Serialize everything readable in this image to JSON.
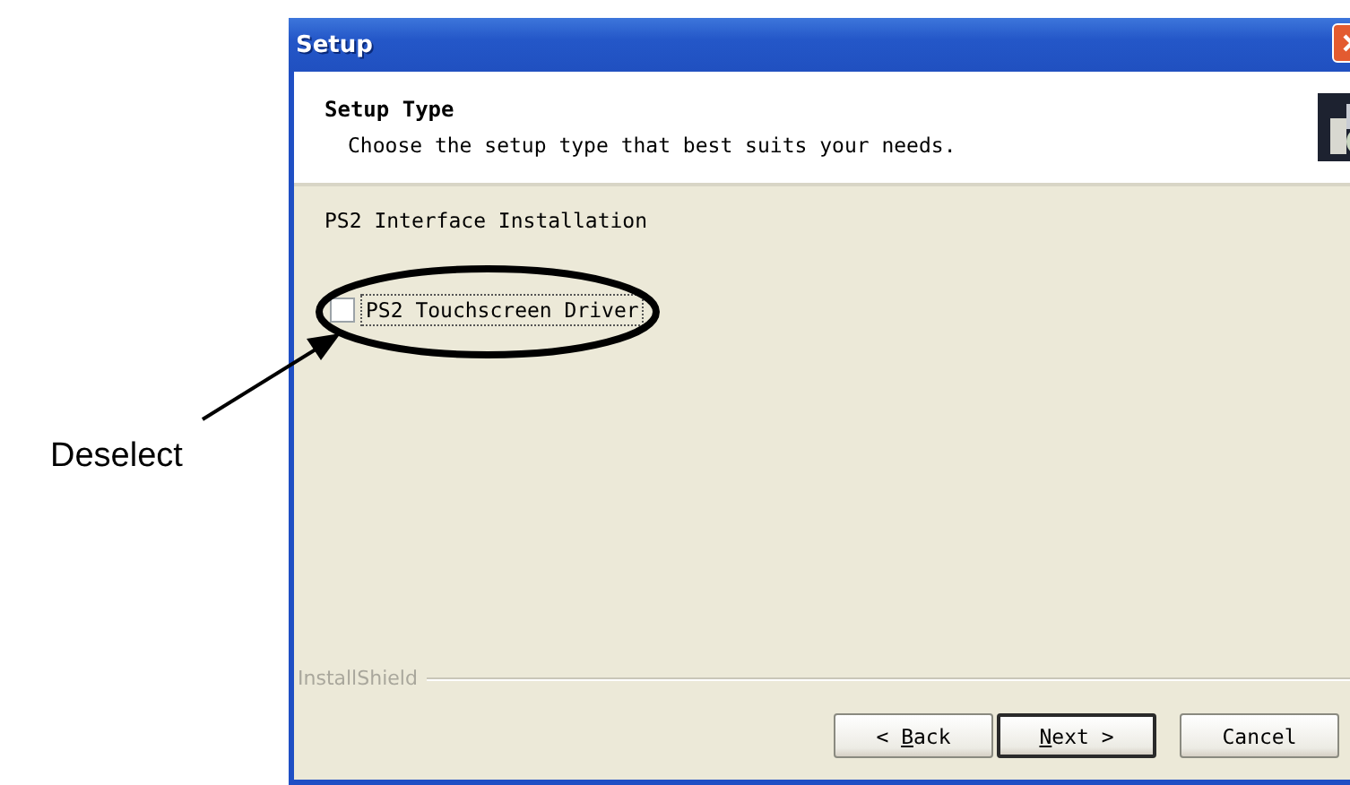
{
  "window": {
    "title": "Setup"
  },
  "header": {
    "title": "Setup Type",
    "subtitle": "Choose the setup type that best suits your needs."
  },
  "group_label": "PS2 Interface Installation",
  "options": [
    {
      "label": "PS2 Touchscreen Driver",
      "checked": false,
      "focused": true
    }
  ],
  "brand": "InstallShield",
  "buttons": [
    {
      "before": "< ",
      "key": "B",
      "after": "ack",
      "default": false
    },
    {
      "key": "N",
      "after": "ext >",
      "default": true
    },
    {
      "before": "Cancel",
      "default": false
    }
  ],
  "annotation": {
    "text": "Deselect"
  }
}
